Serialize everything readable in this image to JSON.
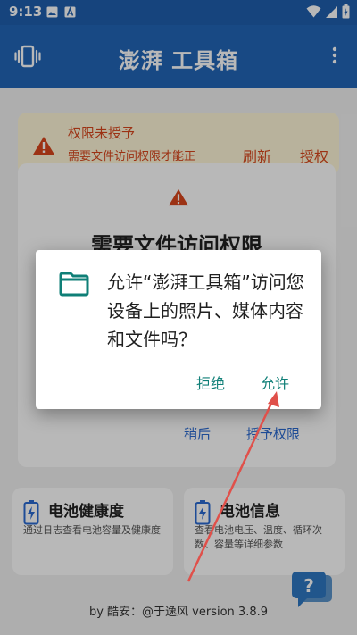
{
  "status_bar": {
    "time": "9:13",
    "icons": [
      "image-icon",
      "a-badge-icon",
      "wifi-icon",
      "signal-icon",
      "battery-charging-icon"
    ]
  },
  "app_bar": {
    "title": "澎湃 工具箱",
    "left_icon": "vibrate-icon",
    "right_icon": "more-vertical-icon"
  },
  "warning_banner": {
    "title": "权限未授予",
    "description": "需要文件访问权限才能正",
    "refresh_label": "刷新",
    "grant_label": "授权"
  },
  "permission_card": {
    "heading": "需要文件访问权限",
    "later_label": "稍后",
    "grant_label": "授予权限"
  },
  "cards": [
    {
      "title": "电池健康度",
      "description": "通过日志查看电池容量及健康度"
    },
    {
      "title": "电池信息",
      "description": "查看电池电压、温度、循环次数、容量等详细参数"
    }
  ],
  "footer": {
    "credit": "by 酷安：@于逸风 version 3.8.9"
  },
  "dialog": {
    "message": "允许“澎湃工具箱”访问您设备上的照片、媒体内容和文件吗？",
    "deny_label": "拒绝",
    "allow_label": "允许"
  },
  "colors": {
    "primary": "#2266b8",
    "status_bar": "#1f5fae",
    "warning": "#d9461c",
    "dialog_accent": "#0f7f77",
    "annotation_arrow": "#e0504a"
  }
}
